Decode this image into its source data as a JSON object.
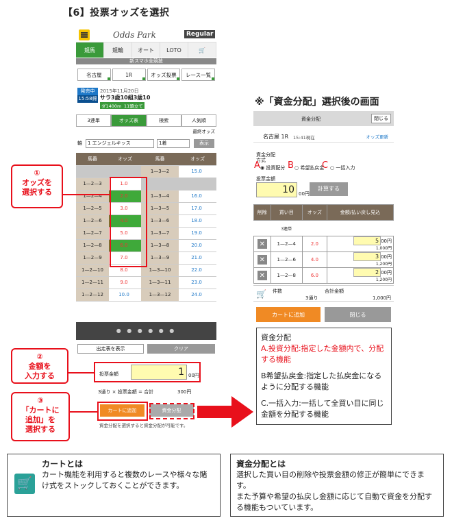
{
  "headings": {
    "step6": "【6】投票オッズを選択",
    "after": "※「資金分配」選択後の画面"
  },
  "phone1": {
    "menu_label": "メニュー",
    "logo": "Odds Park",
    "plan": "Regular",
    "nav": [
      "競馬",
      "競輪",
      "オート",
      "LOTO",
      "cart"
    ],
    "banner": "新スマホ全競技",
    "tabs": [
      "名古屋",
      "1R",
      "オッズ投票",
      "レース一覧"
    ],
    "race_badge": "発売中",
    "race_time": "15:58締",
    "race_date": "2015年11月20日",
    "race_name": "サラ3歳10組3歳10",
    "race_dist": "ダ1400m",
    "race_count": "11頭立て",
    "bet_type": "3連単",
    "odds_nav": [
      "3連単",
      "オッズ表",
      "検索",
      "人気順"
    ],
    "final_odds": "最終オッズ",
    "axis_label": "軸",
    "axis_value": "1 エンジェルキッス",
    "pos_value": "1着",
    "show_btn": "表示",
    "col_head": [
      "馬番",
      "オッズ",
      "馬番",
      "オッズ"
    ],
    "rows": [
      {
        "l": "",
        "lv": "",
        "r": "1—3—2",
        "rv": "15.0"
      },
      {
        "l": "1—2—3",
        "lv": "1.0",
        "r": "",
        "rv": ""
      },
      {
        "l": "1—2—4",
        "lv": "2.0",
        "r": "1—3—4",
        "rv": "16.0"
      },
      {
        "l": "1—2—5",
        "lv": "3.0",
        "r": "1—3—5",
        "rv": "17.0"
      },
      {
        "l": "1—2—6",
        "lv": "4.0",
        "r": "1—3—6",
        "rv": "18.0"
      },
      {
        "l": "1—2—7",
        "lv": "5.0",
        "r": "1—3—7",
        "rv": "19.0"
      },
      {
        "l": "1—2—8",
        "lv": "6.0",
        "r": "1—3—8",
        "rv": "20.0"
      },
      {
        "l": "1—2—9",
        "lv": "7.0",
        "r": "1—3—9",
        "rv": "21.0"
      },
      {
        "l": "1—2—10",
        "lv": "8.0",
        "r": "1—3—10",
        "rv": "22.0"
      },
      {
        "l": "1—2—11",
        "lv": "9.0",
        "r": "1—3—11",
        "rv": "23.0"
      },
      {
        "l": "1—2—12",
        "lv": "10.0",
        "r": "1—3—12",
        "rv": "24.0"
      }
    ],
    "pager": "● ● ● ● ● ●",
    "selected_only": "出走表を表示",
    "clear": "クリア",
    "amount_label": "投票金額",
    "amount_value": "1",
    "amount_unit": "00円",
    "formula": "3通り × 投票金額 = 合計",
    "total": "300円",
    "add_cart": "カートに追加",
    "distribute": "資金分配",
    "note": "資金分配を選択すると資金分配が可能です。"
  },
  "callouts": {
    "c1_num": "①",
    "c1_text": "オッズを\n選択する",
    "c2_num": "②",
    "c2_text": "金額を\n入力する",
    "c3_num": "③",
    "c3_text": "「カートに\n追加」を\n選択する"
  },
  "phone2": {
    "bar_title": "資金分配",
    "close_top": "閉じる",
    "race": "名古屋 1R",
    "race_time": "15:41現在",
    "update": "オッズ更新",
    "method_label": "資金分配\n方式",
    "methods": [
      "投資配分",
      "希望払戻金",
      "一括入力"
    ],
    "letters": [
      "A",
      "B",
      "C"
    ],
    "amount_label": "投票金額",
    "amount_value": "10",
    "amount_unit": "00円",
    "calc_btn": "計算する",
    "col_head": [
      "削除",
      "買い目",
      "オッズ",
      "金額/払い戻し見込"
    ],
    "bet_type": "3連単",
    "rows": [
      {
        "combo": "1—2—4",
        "odds": "2.0",
        "amt": "5",
        "unit": "00円",
        "ret": "1,000円"
      },
      {
        "combo": "1—2—6",
        "odds": "4.0",
        "amt": "3",
        "unit": "00円",
        "ret": "1,200円"
      },
      {
        "combo": "1—2—8",
        "odds": "6.0",
        "amt": "2",
        "unit": "00円",
        "ret": "1,200円"
      }
    ],
    "count_label": "件数",
    "count_value": "3通り",
    "sum_label": "合計金額",
    "sum_value": "1,000円",
    "add_cart": "カートに追加",
    "close": "閉じる"
  },
  "explain": {
    "title": "資金分配",
    "a": "A.投資分配:指定した金額内で、分配する機能",
    "b": "B希望払戻金:指定した払戻金になるように分配する機能",
    "c": "C.一括入力:一括して全買い目に同じ金額を分配する機能"
  },
  "cart_note": {
    "title": "カートとは",
    "body": "カート機能を利用すると複数のレースや様々な賭け式をストックしておくことができます。"
  },
  "fund_note": {
    "title": "資金分配とは",
    "body1": "選択した買い目の削除や投票金額の修正が簡単にできます。",
    "body2": "また予算や希望の払戻し金額に応じて自動で資金を分配する機能もついています。"
  }
}
